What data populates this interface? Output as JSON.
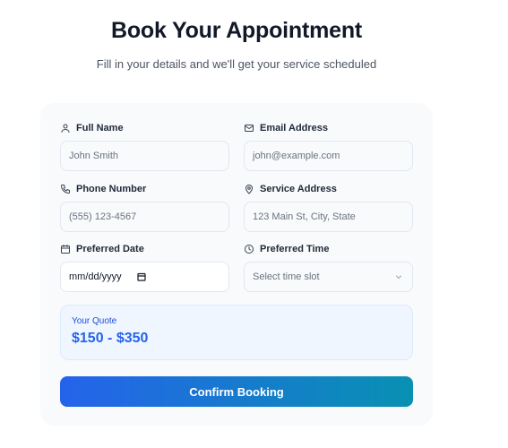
{
  "header": {
    "title": "Book Your Appointment",
    "subtitle": "Fill in your details and we'll get your service scheduled"
  },
  "form": {
    "full_name": {
      "label": "Full Name",
      "placeholder": "John Smith",
      "icon": "user-icon"
    },
    "email": {
      "label": "Email Address",
      "placeholder": "john@example.com",
      "icon": "mail-icon"
    },
    "phone": {
      "label": "Phone Number",
      "placeholder": "(555) 123-4567",
      "icon": "phone-icon"
    },
    "address": {
      "label": "Service Address",
      "placeholder": "123 Main St, City, State",
      "icon": "map-pin-icon"
    },
    "date": {
      "label": "Preferred Date",
      "value": "mm/dd/yyyy",
      "icon": "calendar-icon"
    },
    "time": {
      "label": "Preferred Time",
      "value": "Select time slot",
      "icon": "clock-icon"
    }
  },
  "quote": {
    "label": "Your Quote",
    "value": "$150 - $350"
  },
  "submit": {
    "label": "Confirm Booking"
  },
  "colors": {
    "accent_start": "#2563eb",
    "accent_end": "#0891b2",
    "quote_bg": "#eff6ff"
  }
}
